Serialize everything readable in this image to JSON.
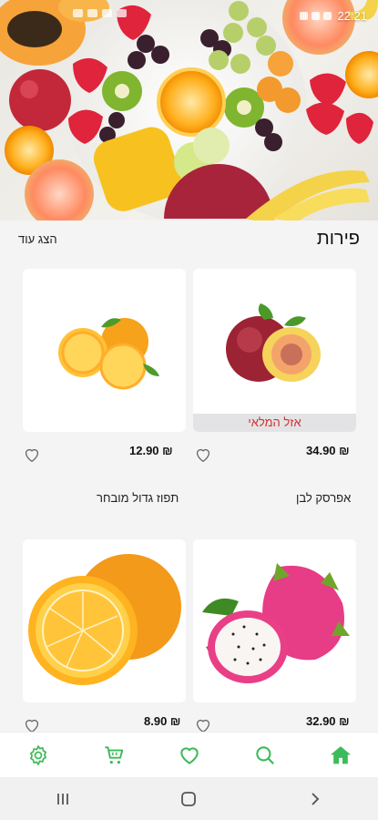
{
  "status": {
    "time": "22:21"
  },
  "section": {
    "title": "פירות",
    "show_more": "הצג עוד"
  },
  "products": [
    {
      "name": "אפרסק לבן",
      "price": "34.90 ₪",
      "badge": "אזל המלאי"
    },
    {
      "name": "תפוז גדול מובחר",
      "price": "12.90 ₪"
    },
    {
      "name": "",
      "price": "32.90 ₪"
    },
    {
      "name": "",
      "price": "8.90 ₪"
    }
  ],
  "nav": {
    "active_color": "#3dbb5a"
  }
}
